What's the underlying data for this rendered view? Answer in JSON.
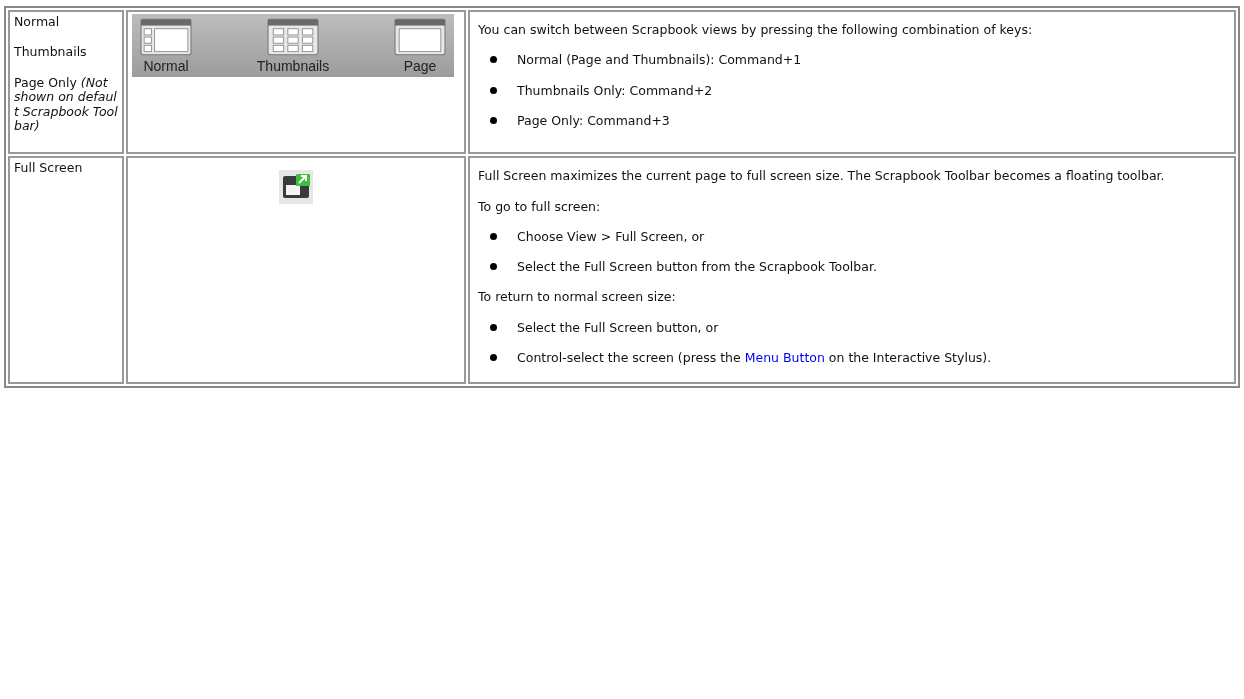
{
  "rows": [
    {
      "name": [
        "Normal",
        "Thumbnails",
        "Page Only *(Not shown on default Scrapbook Toolbar)*"
      ],
      "toolbar": [
        "Normal",
        "Thumbnails",
        "Page"
      ],
      "description": [
        {
          "kind": "paragraph",
          "text": "You can switch between Scrapbook views by pressing the following combination of keys:"
        },
        {
          "kind": "bullet",
          "text": "Normal (Page and Thumbnails): Command+1"
        },
        {
          "kind": "bullet",
          "text": "Thumbnails Only: Command+2"
        },
        {
          "kind": "bullet",
          "text": "Page Only: Command+3"
        }
      ]
    },
    {
      "name": [
        "Full Screen"
      ],
      "toolbar": [],
      "description": [
        {
          "kind": "paragraph",
          "text": "Full Screen maximizes the current page to full screen size. The Scrapbook Toolbar becomes a floating toolbar."
        },
        {
          "kind": "paragraph",
          "text": "To go to full screen:"
        },
        {
          "kind": "bullet",
          "text": "Choose View > Full Screen, or"
        },
        {
          "kind": "bullet",
          "text": "Select the Full Screen button from the Scrapbook Toolbar."
        },
        {
          "kind": "paragraph",
          "text": "To return to normal screen size:"
        },
        {
          "kind": "bullet",
          "text": "Select the Full Screen button, or"
        },
        {
          "kind": "bullet",
          "text": " Control-select the screen (press the ",
          "link": "Menu Button",
          "after": " on the Interactive Stylus)."
        }
      ]
    }
  ]
}
